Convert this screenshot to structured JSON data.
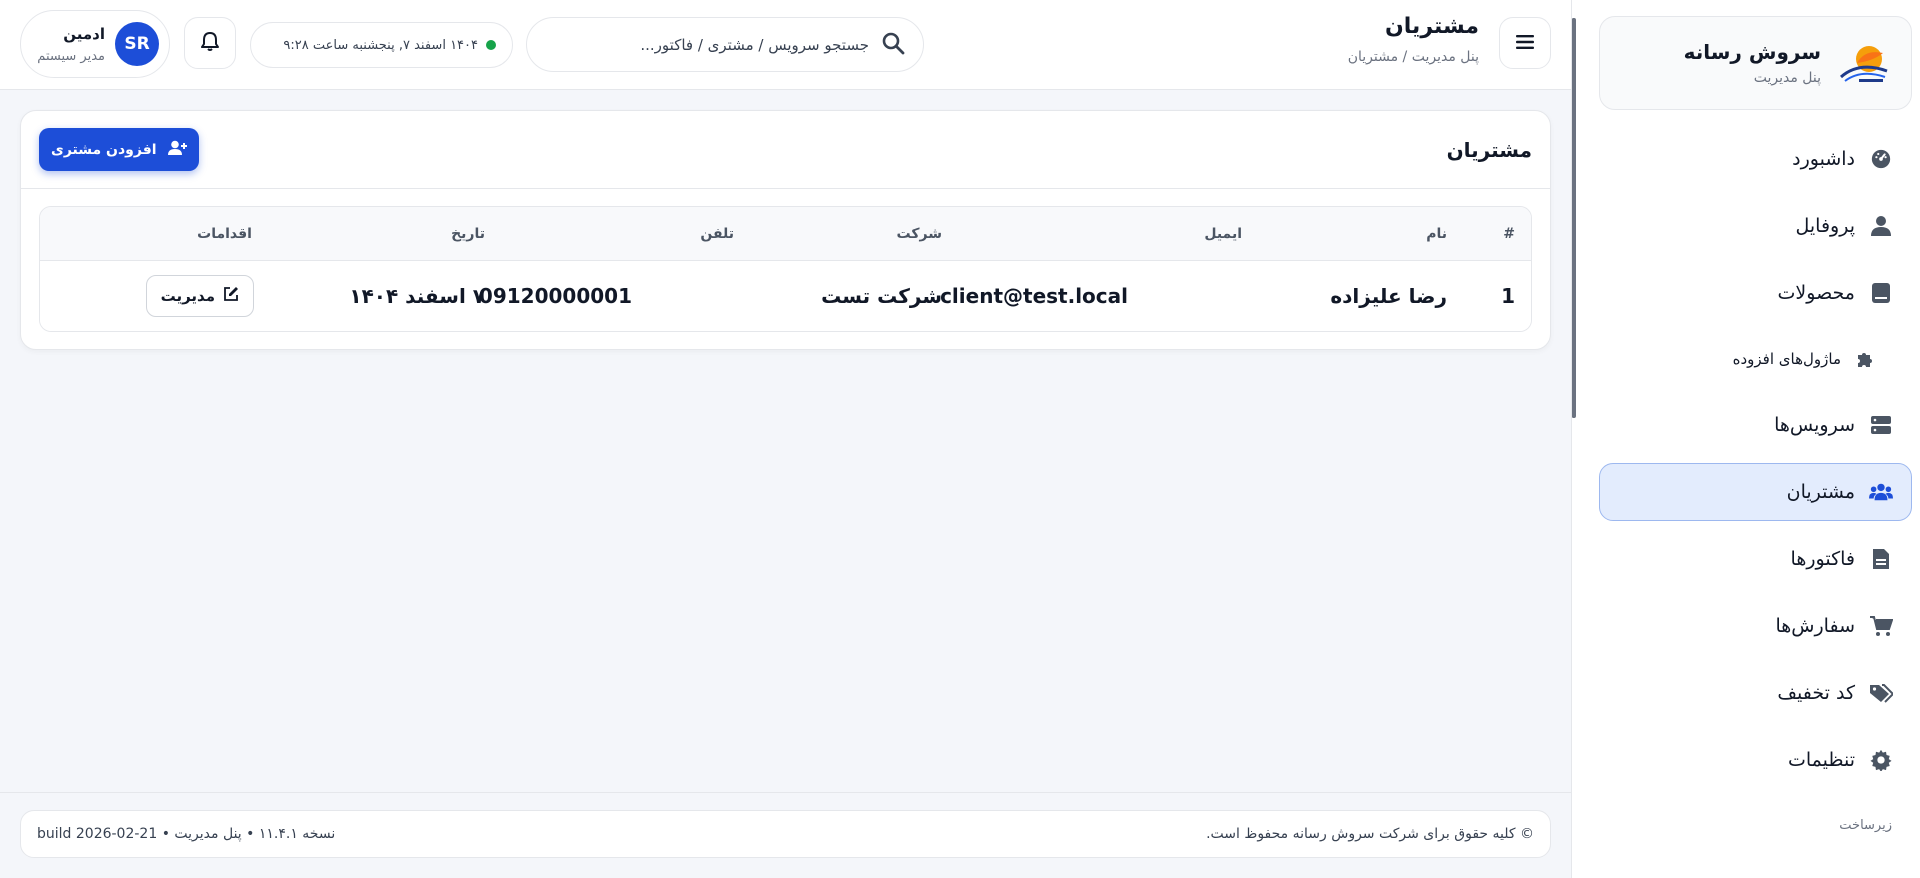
{
  "brand": {
    "title": "سروش رسانه",
    "subtitle": "پنل مدیریت",
    "logo_icon": "satellite-dish-logo"
  },
  "sidebar": {
    "items": [
      {
        "label": "داشبورد",
        "icon": "gauge-icon"
      },
      {
        "label": "پروفایل",
        "icon": "user-icon"
      },
      {
        "label": "محصولات",
        "icon": "box-icon"
      },
      {
        "label": "ماژول‌های افزوده",
        "icon": "puzzle-icon"
      },
      {
        "label": "سرویس‌ها",
        "icon": "server-icon"
      },
      {
        "label": "مشتریان",
        "icon": "users-icon",
        "active": true
      },
      {
        "label": "فاکتورها",
        "icon": "invoice-icon"
      },
      {
        "label": "سفارش‌ها",
        "icon": "cart-icon"
      },
      {
        "label": "کد تخفیف",
        "icon": "tags-icon"
      },
      {
        "label": "تنظیمات",
        "icon": "gear-icon"
      }
    ],
    "section_label": "زیرساخت"
  },
  "header": {
    "title": "مشتریان",
    "breadcrumb": "پنل مدیریت / مشتریان",
    "search_placeholder": "جستجو سرویس / مشتری / فاکتور...",
    "datetime": "۱۴۰۴ اسفند ۷, پنجشنبه ساعت ۹:۲۸",
    "status_color": "#16a34a"
  },
  "user": {
    "initials": "SR",
    "name": "ادمین",
    "role": "مدیر سیستم"
  },
  "card": {
    "title": "مشتریان",
    "add_button": "افزودن مشتری",
    "columns": [
      "#",
      "نام",
      "ایمیل",
      "شرکت",
      "تلفن",
      "تاریخ",
      "اقدامات"
    ],
    "rows": [
      {
        "index": "1",
        "name": "رضا علیزاده",
        "email": "client@test.local",
        "company": "شرکت تست",
        "phone": "09120000001",
        "date": "۷ اسفند ۱۴۰۴",
        "action": "مدیریت"
      }
    ]
  },
  "footer": {
    "copyright": "© کلیه حقوق برای شرکت سروش رسانه محفوظ است.",
    "version": "نسخه ۱۱.۴.۱ • پنل مدیریت • build 2026-02-21"
  },
  "colors": {
    "accent": "#1d4ed8",
    "active_bg": "#e3ecfd",
    "active_border": "#9db8ef"
  }
}
